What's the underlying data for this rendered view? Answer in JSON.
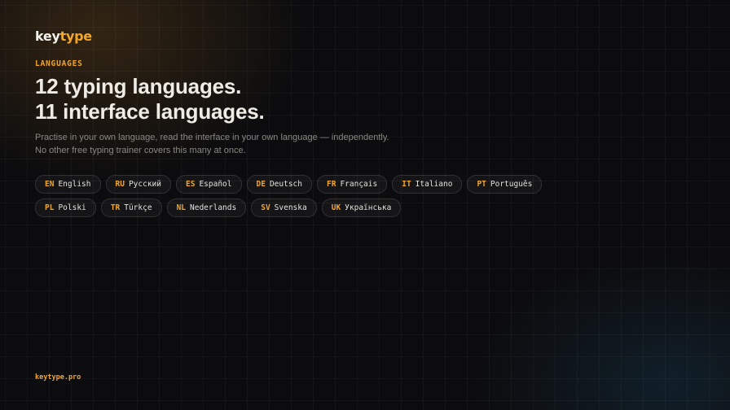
{
  "brand": {
    "part1": "key",
    "part2": "type"
  },
  "section_label": "LANGUAGES",
  "headline": {
    "line1": "12 typing languages.",
    "line2": "11 interface languages."
  },
  "subtitle": "Practise in your own language, read the interface in your own language — independently. No other free typing trainer covers this many at once.",
  "languages": [
    {
      "code": "EN",
      "name": "English"
    },
    {
      "code": "RU",
      "name": "Русский"
    },
    {
      "code": "ES",
      "name": "Español"
    },
    {
      "code": "DE",
      "name": "Deutsch"
    },
    {
      "code": "FR",
      "name": "Français"
    },
    {
      "code": "IT",
      "name": "Italiano"
    },
    {
      "code": "PT",
      "name": "Português"
    },
    {
      "code": "PL",
      "name": "Polski"
    },
    {
      "code": "TR",
      "name": "Türkçe"
    },
    {
      "code": "NL",
      "name": "Nederlands"
    },
    {
      "code": "SV",
      "name": "Svenska"
    },
    {
      "code": "UK",
      "name": "Українська"
    }
  ],
  "footer_link": "keytype.pro",
  "colors": {
    "accent": "#f5a623",
    "background": "#0c0c0e",
    "text": "#efece6",
    "muted": "#8a8883"
  }
}
